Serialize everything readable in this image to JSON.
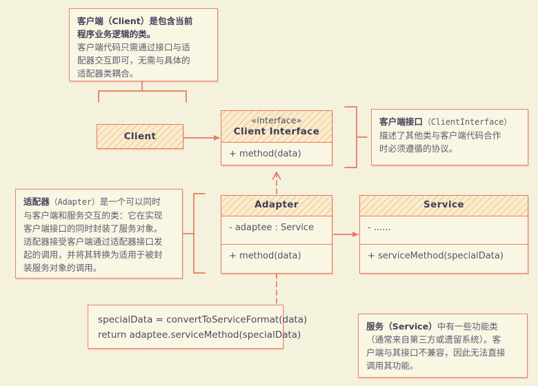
{
  "diagram": {
    "title": "Adapter design pattern UML diagram",
    "colors": {
      "background": "#f4f1dd",
      "stroke": "#e8775c",
      "note_fill": "#faf6e4",
      "header_fill": "#f9eccf",
      "text": "#4b4960"
    }
  },
  "notes": {
    "client": {
      "bold_line1": "客户端（Client）是包含当前",
      "bold_line2": "程序业务逻辑的类。",
      "body_line1": "客户端代码只需通过接口与适",
      "body_line2": "配器交互即可，无需与具体的",
      "body_line3": "适配器类耦合。"
    },
    "client_interface": {
      "bold": "客户端接口",
      "mono": "（ClientInterface）",
      "body_line1": "描述了其他类与客户端代码合作",
      "body_line2": "时必须遵循的协议。"
    },
    "adapter": {
      "bold": "适配器",
      "mono": "（Adapter）",
      "body_line1": "是一个可以同时",
      "body_line2": "与客户端和服务交互的类：它在实现",
      "body_line3": "客户端接口的同时封装了服务对象。",
      "body_line4": "适配器接受客户端通过适配器接口发",
      "body_line5": "起的调用，并将其转换为适用于被封",
      "body_line6": "装服务对象的调用。"
    },
    "service": {
      "bold": "服务（Service）",
      "body_line1": "中有一些功能类",
      "body_line2": "（通常来自第三方或遗留系统）。客",
      "body_line3": "户端与其接口不兼容，因此无法直接",
      "body_line4": "调用其功能。"
    },
    "code": {
      "line1": "specialData = convertToServiceFormat(data)",
      "line2": "return adaptee.serviceMethod(specialData)"
    }
  },
  "classes": {
    "client": {
      "name": "Client"
    },
    "client_interface": {
      "stereotype": "«interface»",
      "name": "Client Interface",
      "methods": [
        "+ method(data)"
      ]
    },
    "adapter": {
      "name": "Adapter",
      "fields": [
        "- adaptee : Service"
      ],
      "methods": [
        "+ method(data)"
      ]
    },
    "service": {
      "name": "Service",
      "fields": [
        "- ......"
      ],
      "methods": [
        "+ serviceMethod(specialData)"
      ]
    }
  }
}
